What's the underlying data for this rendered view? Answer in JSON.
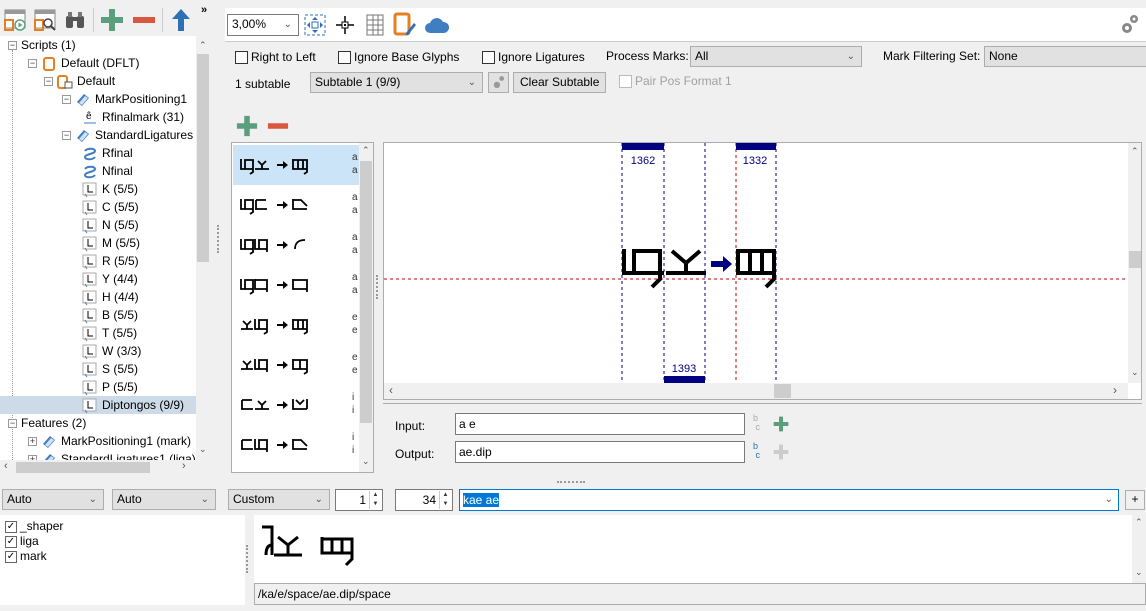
{
  "left_toolbar": {
    "icons": [
      "preview-window-icon",
      "inspect-window-icon",
      "binoculars-icon",
      "add-icon",
      "remove-icon",
      "move-up-icon"
    ],
    "overflow": "»"
  },
  "tree": {
    "nodes": [
      {
        "label": "Scripts (1)",
        "icon": "collapse"
      },
      {
        "label": "Default (DFLT)",
        "icon": "script-icon"
      },
      {
        "label": "Default",
        "icon": "language-icon"
      },
      {
        "label": "MarkPositioning1",
        "icon": "lookup-icon"
      },
      {
        "label": "Rfinalmark (31)",
        "icon": "mark-icon"
      },
      {
        "label": "StandardLigatures",
        "icon": "lookup-icon"
      },
      {
        "label": "Rfinal",
        "icon": "contextual-icon"
      },
      {
        "label": "Nfinal",
        "icon": "contextual-icon"
      },
      {
        "label": "K (5/5)",
        "icon": "ligature-icon"
      },
      {
        "label": "C (5/5)",
        "icon": "ligature-icon"
      },
      {
        "label": "N (5/5)",
        "icon": "ligature-icon"
      },
      {
        "label": "M (5/5)",
        "icon": "ligature-icon"
      },
      {
        "label": "R (5/5)",
        "icon": "ligature-icon"
      },
      {
        "label": "Y (4/4)",
        "icon": "ligature-icon"
      },
      {
        "label": "H (4/4)",
        "icon": "ligature-icon"
      },
      {
        "label": "B (5/5)",
        "icon": "ligature-icon"
      },
      {
        "label": "T (5/5)",
        "icon": "ligature-icon"
      },
      {
        "label": "W (3/3)",
        "icon": "ligature-icon"
      },
      {
        "label": "S (5/5)",
        "icon": "ligature-icon"
      },
      {
        "label": "P (5/5)",
        "icon": "ligature-icon"
      },
      {
        "label": "Diptongos (9/9)",
        "icon": "ligature-icon"
      },
      {
        "label": "Features (2)",
        "icon": "collapse"
      },
      {
        "label": "MarkPositioning1 (mark)",
        "icon": "lookup-icon"
      },
      {
        "label": "StandardLigatures1 (liga)",
        "icon": "lookup-icon"
      }
    ],
    "selected": "Diptongos (9/9)"
  },
  "toolbar": {
    "zoom": "3,00%"
  },
  "options": {
    "right_to_left": "Right to Left",
    "ignore_base_glyphs": "Ignore Base Glyphs",
    "ignore_ligatures": "Ignore Ligatures",
    "process_marks_label": "Process Marks:",
    "process_marks_value": "All",
    "mark_filtering_label": "Mark Filtering Set:",
    "mark_filtering_value": "None",
    "subtable_count": "1 subtable",
    "subtable_value": "Subtable 1 (9/9)",
    "clear_subtable": "Clear Subtable",
    "pair_pos_format": "Pair Pos Format 1"
  },
  "rules": [
    {
      "in1": "a",
      "in2": "a"
    },
    {
      "in1": "a",
      "in2": "a"
    },
    {
      "in1": "a",
      "in2": "a"
    },
    {
      "in1": "a",
      "in2": "a"
    },
    {
      "in1": "e",
      "in2": "e"
    },
    {
      "in1": "e",
      "in2": "e"
    },
    {
      "in1": "i",
      "in2": "i"
    },
    {
      "in1": "i",
      "in2": "i"
    }
  ],
  "preview": {
    "width1": "1362",
    "width2": "1393",
    "width3": "1332"
  },
  "rule_editor": {
    "input_label": "Input:",
    "input_value": "a e",
    "output_label": "Output:",
    "output_value": "ae.dip"
  },
  "bottom": {
    "select1": "Auto",
    "select2": "Auto",
    "select3": "Custom",
    "spin1": "1",
    "spin2": "34",
    "text": "kae ae",
    "add": "+",
    "features": [
      "_shaper",
      "liga",
      "mark"
    ],
    "glyph_string": "/ka/e/space/ae.dip/space"
  },
  "colors": {
    "accent_blue": "#000080",
    "add_green": "#5b9e7d",
    "remove_red": "#d9573e",
    "baseline_red": "#c00000"
  }
}
